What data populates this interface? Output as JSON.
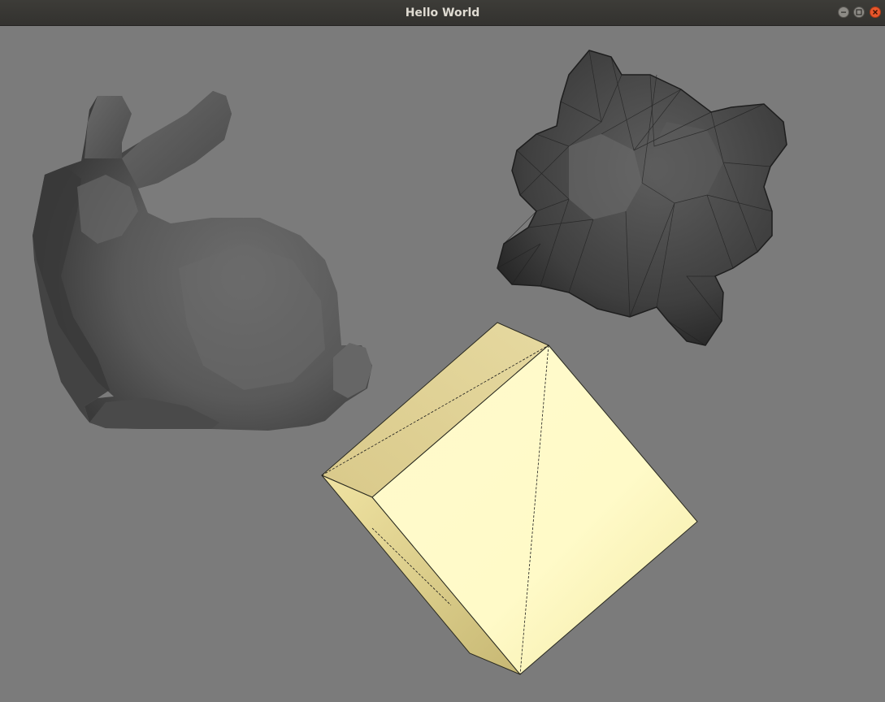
{
  "window": {
    "title": "Hello World",
    "buttons": [
      "minimize",
      "maximize",
      "close"
    ]
  },
  "viewport": {
    "background_color": "#7b7b7b",
    "objects": [
      {
        "name": "bunny",
        "color": "#5a5a5a",
        "shading": "smooth"
      },
      {
        "name": "spiky-blob",
        "color": "#4a4a4a",
        "shading": "flat-wireframe"
      },
      {
        "name": "box",
        "color": "#fff6b8",
        "shading": "flat-wireframe"
      }
    ]
  }
}
